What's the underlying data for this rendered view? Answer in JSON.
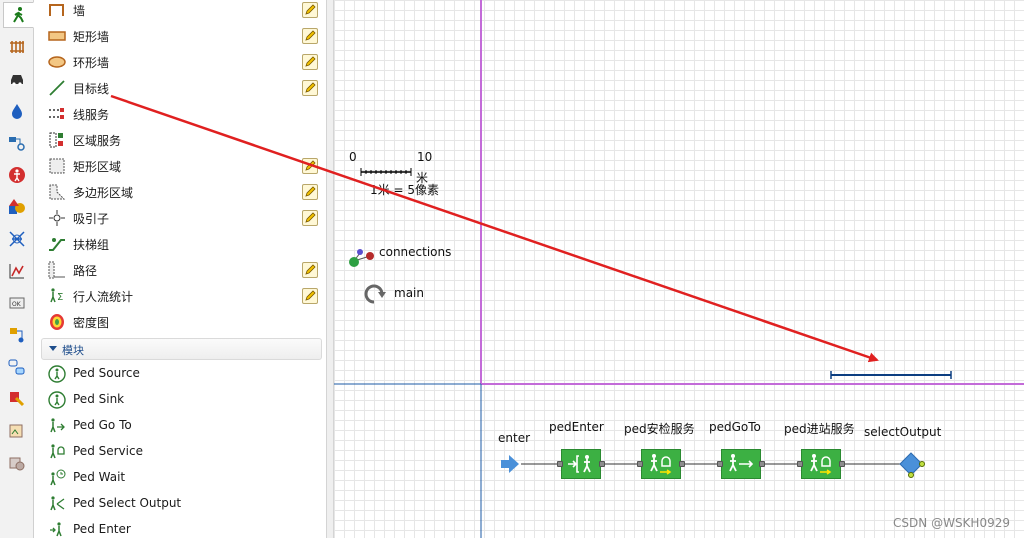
{
  "toolstrip": {
    "tools": [
      {
        "name": "pedestrian-library-icon",
        "color": "#1a7a1a"
      },
      {
        "name": "rail-library-icon",
        "color": "#b5651d"
      },
      {
        "name": "road-traffic-library-icon",
        "color": "#333333"
      },
      {
        "name": "fluid-library-icon",
        "color": "#1f5fbf"
      },
      {
        "name": "process-modeling-library-icon",
        "color": "#2a6db0"
      },
      {
        "name": "agent-icon",
        "color": "#d32f2f"
      },
      {
        "name": "presentation-icon",
        "color": "#e0a000"
      },
      {
        "name": "space-markup-icon",
        "color": "#1f5fbf"
      },
      {
        "name": "analysis-icon",
        "color": "#c62828"
      },
      {
        "name": "controls-icon",
        "color": "#666666"
      },
      {
        "name": "system-dynamics-icon",
        "color": "#1f5fbf"
      },
      {
        "name": "statechart-icon",
        "color": "#1f5fbf"
      },
      {
        "name": "connectivity-icon",
        "color": "#e0a000"
      },
      {
        "name": "pictures-icon",
        "color": "#8d6e63"
      },
      {
        "name": "3d-objects-icon",
        "color": "#8d6e63"
      }
    ]
  },
  "palette": {
    "items": [
      {
        "label": "墙",
        "icon": "wall-icon",
        "editable": true
      },
      {
        "label": "矩形墙",
        "icon": "rectangular-wall-icon",
        "editable": true
      },
      {
        "label": "环形墙",
        "icon": "circular-wall-icon",
        "editable": true
      },
      {
        "label": "目标线",
        "icon": "target-line-icon",
        "editable": true
      },
      {
        "label": "线服务",
        "icon": "service-with-lines-icon",
        "editable": false
      },
      {
        "label": "区域服务",
        "icon": "service-with-areas-icon",
        "editable": false
      },
      {
        "label": "矩形区域",
        "icon": "rectangular-area-icon",
        "editable": true
      },
      {
        "label": "多边形区域",
        "icon": "polygonal-area-icon",
        "editable": true
      },
      {
        "label": "吸引子",
        "icon": "attractor-icon",
        "editable": true
      },
      {
        "label": "扶梯组",
        "icon": "escalator-group-icon",
        "editable": false
      },
      {
        "label": "路径",
        "icon": "path-icon",
        "editable": true
      },
      {
        "label": "行人流统计",
        "icon": "ped-flow-statistics-icon",
        "editable": true
      },
      {
        "label": "密度图",
        "icon": "density-map-icon",
        "editable": false
      }
    ],
    "section_label": "模块",
    "blocks": [
      {
        "label": "Ped Source",
        "icon": "ped-source-icon"
      },
      {
        "label": "Ped Sink",
        "icon": "ped-sink-icon"
      },
      {
        "label": "Ped Go To",
        "icon": "ped-goto-icon"
      },
      {
        "label": "Ped Service",
        "icon": "ped-service-icon"
      },
      {
        "label": "Ped Wait",
        "icon": "ped-wait-icon"
      },
      {
        "label": "Ped Select Output",
        "icon": "ped-select-output-icon"
      },
      {
        "label": "Ped Enter",
        "icon": "ped-enter-icon"
      }
    ]
  },
  "canvas": {
    "scale": {
      "zero": "0",
      "ten": "10",
      "unit": "米",
      "ratio": "1米 = 5像素"
    },
    "connections_label": "connections",
    "main_label": "main",
    "flow": {
      "enter_label": "enter",
      "blocks": [
        {
          "label": "pedEnter",
          "icon": "ped-enter-block-icon"
        },
        {
          "label": "ped安检服务",
          "icon": "ped-service-block-icon"
        },
        {
          "label": "pedGoTo",
          "icon": "ped-goto-block-icon"
        },
        {
          "label": "ped进站服务",
          "icon": "ped-service-block-icon"
        },
        {
          "label": "selectOutput",
          "icon": "select-output-diamond-icon"
        }
      ]
    },
    "watermark": "CSDN @WSKH0929",
    "colors": {
      "frame_purple": "#c36bd8",
      "frame_blue": "#1b5aa6",
      "arrow_red": "#e02020",
      "block_green": "#3cb043",
      "target_line": "#0b3d80"
    }
  }
}
